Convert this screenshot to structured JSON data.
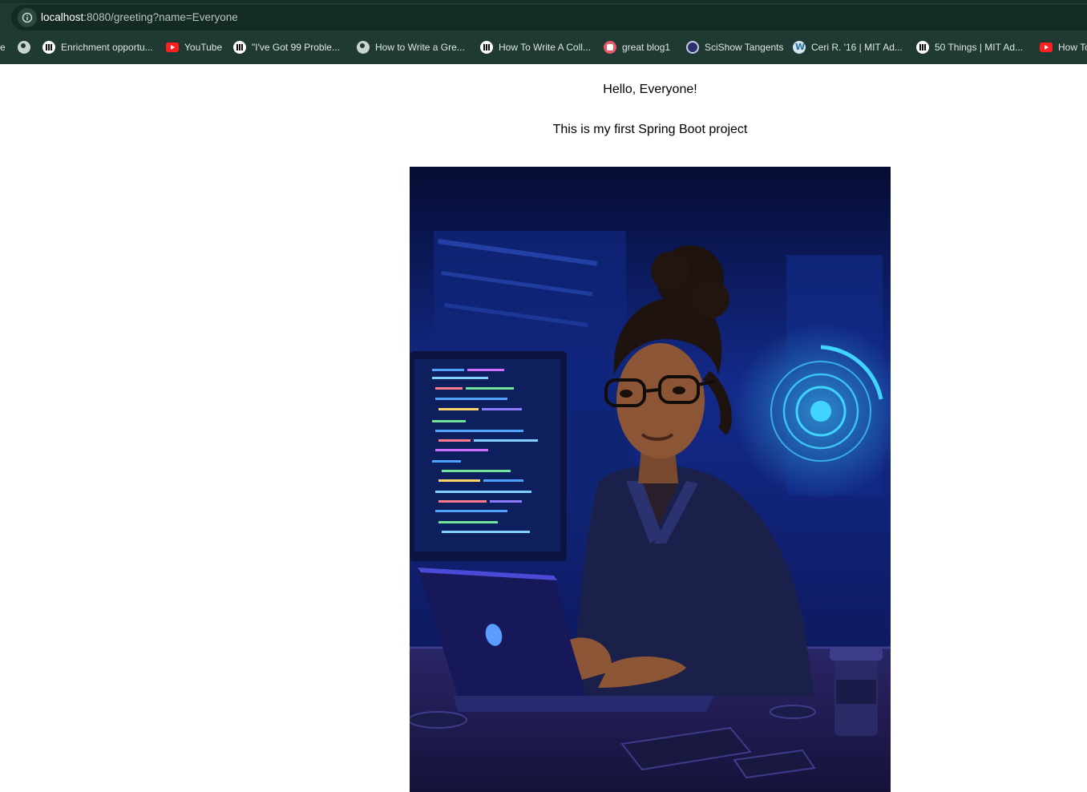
{
  "browser": {
    "url_host": "localhost",
    "url_path": ":8080/greeting?name=Everyone",
    "bookmarks": [
      {
        "label": "e",
        "icon": "folder-icon"
      },
      {
        "label": "",
        "icon": "globe-icon"
      },
      {
        "label": "Enrichment opportu...",
        "icon": "mit-logo-icon"
      },
      {
        "label": "YouTube",
        "icon": "youtube-icon"
      },
      {
        "label": "\"I've Got 99 Proble...",
        "icon": "mit-logo-icon"
      },
      {
        "label": "How to Write a Gre...",
        "icon": "globe-icon"
      },
      {
        "label": "How To Write A Coll...",
        "icon": "mit-logo-icon"
      },
      {
        "label": "great  blog1",
        "icon": "blog-icon"
      },
      {
        "label": "SciShow Tangents",
        "icon": "scishow-icon"
      },
      {
        "label": "Ceri R. '16 | MIT Ad...",
        "icon": "wordpress-icon"
      },
      {
        "label": "50 Things | MIT Ad...",
        "icon": "mit-logo-icon"
      },
      {
        "label": "How To",
        "icon": "youtube-icon"
      }
    ]
  },
  "page": {
    "greeting": "Hello, Everyone!",
    "subtitle": "This is my first Spring Boot project"
  }
}
